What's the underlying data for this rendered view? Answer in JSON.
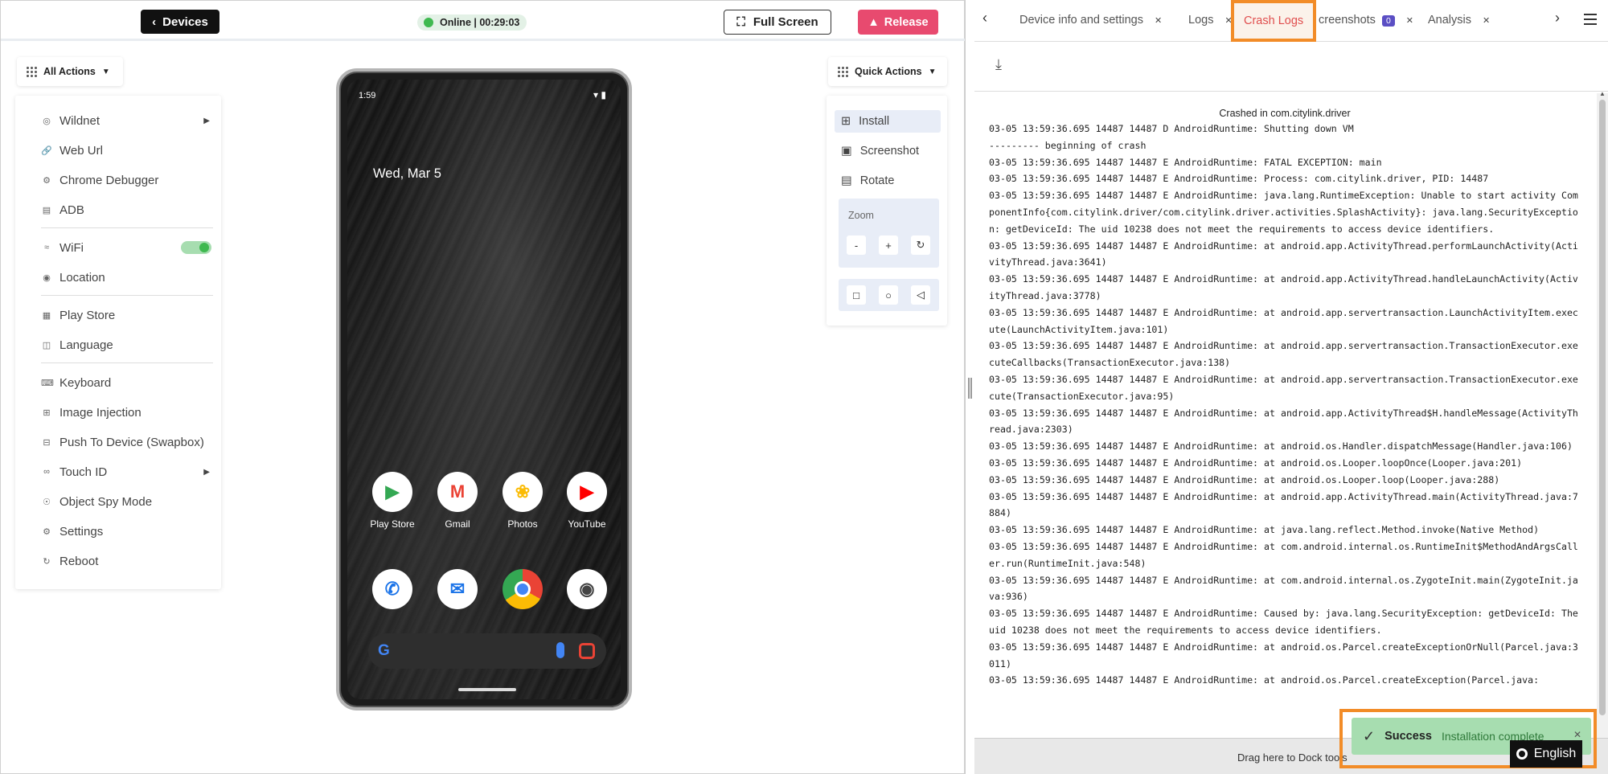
{
  "header": {
    "devices_label": "Devices",
    "status_text": "Online | 00:29:03",
    "fullscreen_label": "Full Screen",
    "release_label": "Release"
  },
  "all_actions": {
    "label": "All Actions",
    "items": [
      {
        "label": "Wildnet",
        "icon": "wildnet-icon",
        "has_submenu": true
      },
      {
        "label": "Web Url",
        "icon": "link-icon"
      },
      {
        "label": "Chrome Debugger",
        "icon": "bug-icon"
      },
      {
        "label": "ADB",
        "icon": "adb-icon"
      },
      {
        "label": "WiFi",
        "icon": "wifi-icon",
        "toggle": true
      },
      {
        "label": "Location",
        "icon": "location-icon"
      },
      {
        "label": "Play Store",
        "icon": "grid-icon"
      },
      {
        "label": "Language",
        "icon": "language-icon"
      },
      {
        "label": "Keyboard",
        "icon": "keyboard-icon"
      },
      {
        "label": "Image Injection",
        "icon": "image-injection-icon"
      },
      {
        "label": "Push To Device (Swapbox)",
        "icon": "push-icon"
      },
      {
        "label": "Touch ID",
        "icon": "fingerprint-icon",
        "has_submenu": true
      },
      {
        "label": "Object Spy Mode",
        "icon": "spy-icon"
      },
      {
        "label": "Settings",
        "icon": "gear-icon"
      },
      {
        "label": "Reboot",
        "icon": "reboot-icon"
      }
    ]
  },
  "phone": {
    "time": "1:59",
    "date": "Wed, Mar 5",
    "apps_row1": [
      {
        "label": "Play Store"
      },
      {
        "label": "Gmail"
      },
      {
        "label": "Photos"
      },
      {
        "label": "YouTube"
      }
    ]
  },
  "quick_actions": {
    "label": "Quick Actions",
    "items": [
      {
        "label": "Install",
        "icon": "install-icon"
      },
      {
        "label": "Screenshot",
        "icon": "screenshot-icon"
      },
      {
        "label": "Rotate",
        "icon": "rotate-icon"
      }
    ],
    "zoom_label": "Zoom",
    "zoom_minus": "-",
    "zoom_plus": "+"
  },
  "tabs": [
    {
      "label": "Device info and settings"
    },
    {
      "label": "Logs"
    },
    {
      "label": "Crash Logs",
      "active": true
    },
    {
      "label": "creenshots",
      "badge": "0"
    },
    {
      "label": "Analysis"
    }
  ],
  "crash": {
    "title": "Crashed in com.citylink.driver",
    "lines": [
      "03-05 13:59:36.695 14487 14487 D AndroidRuntime: Shutting down VM",
      "--------- beginning of crash",
      "03-05 13:59:36.695 14487 14487 E AndroidRuntime: FATAL EXCEPTION: main",
      "03-05 13:59:36.695 14487 14487 E AndroidRuntime: Process: com.citylink.driver, PID: 14487",
      "03-05 13:59:36.695 14487 14487 E AndroidRuntime: java.lang.RuntimeException: Unable to start activity ComponentInfo{com.citylink.driver/com.citylink.driver.activities.SplashActivity}: java.lang.SecurityException: getDeviceId: The uid 10238 does not meet the requirements to access device identifiers.",
      "03-05 13:59:36.695 14487 14487 E AndroidRuntime: at android.app.ActivityThread.performLaunchActivity(ActivityThread.java:3641)",
      "03-05 13:59:36.695 14487 14487 E AndroidRuntime: at android.app.ActivityThread.handleLaunchActivity(ActivityThread.java:3778)",
      "03-05 13:59:36.695 14487 14487 E AndroidRuntime: at android.app.servertransaction.LaunchActivityItem.execute(LaunchActivityItem.java:101)",
      "03-05 13:59:36.695 14487 14487 E AndroidRuntime: at android.app.servertransaction.TransactionExecutor.executeCallbacks(TransactionExecutor.java:138)",
      "03-05 13:59:36.695 14487 14487 E AndroidRuntime: at android.app.servertransaction.TransactionExecutor.execute(TransactionExecutor.java:95)",
      "03-05 13:59:36.695 14487 14487 E AndroidRuntime: at android.app.ActivityThread$H.handleMessage(ActivityThread.java:2303)",
      "03-05 13:59:36.695 14487 14487 E AndroidRuntime: at android.os.Handler.dispatchMessage(Handler.java:106)",
      "03-05 13:59:36.695 14487 14487 E AndroidRuntime: at android.os.Looper.loopOnce(Looper.java:201)",
      "03-05 13:59:36.695 14487 14487 E AndroidRuntime: at android.os.Looper.loop(Looper.java:288)",
      "03-05 13:59:36.695 14487 14487 E AndroidRuntime: at android.app.ActivityThread.main(ActivityThread.java:7884)",
      "03-05 13:59:36.695 14487 14487 E AndroidRuntime: at java.lang.reflect.Method.invoke(Native Method)",
      "03-05 13:59:36.695 14487 14487 E AndroidRuntime: at com.android.internal.os.RuntimeInit$MethodAndArgsCaller.run(RuntimeInit.java:548)",
      "03-05 13:59:36.695 14487 14487 E AndroidRuntime: at com.android.internal.os.ZygoteInit.main(ZygoteInit.java:936)",
      "03-05 13:59:36.695 14487 14487 E AndroidRuntime: Caused by: java.lang.SecurityException: getDeviceId: The uid 10238 does not meet the requirements to access device identifiers.",
      "03-05 13:59:36.695 14487 14487 E AndroidRuntime: at android.os.Parcel.createExceptionOrNull(Parcel.java:3011)",
      "03-05 13:59:36.695 14487 14487 E AndroidRuntime: at android.os.Parcel.createException(Parcel.java:"
    ]
  },
  "dock": {
    "text": "Drag here to Dock tools"
  },
  "toast": {
    "title": "Success",
    "message": "Installation complete"
  },
  "language": {
    "label": "English"
  },
  "colors": {
    "accent_orange": "#f28c28",
    "release_pink": "#e84a6f",
    "success_green": "#a7ddb0",
    "badge_purple": "#5b4fc4"
  }
}
